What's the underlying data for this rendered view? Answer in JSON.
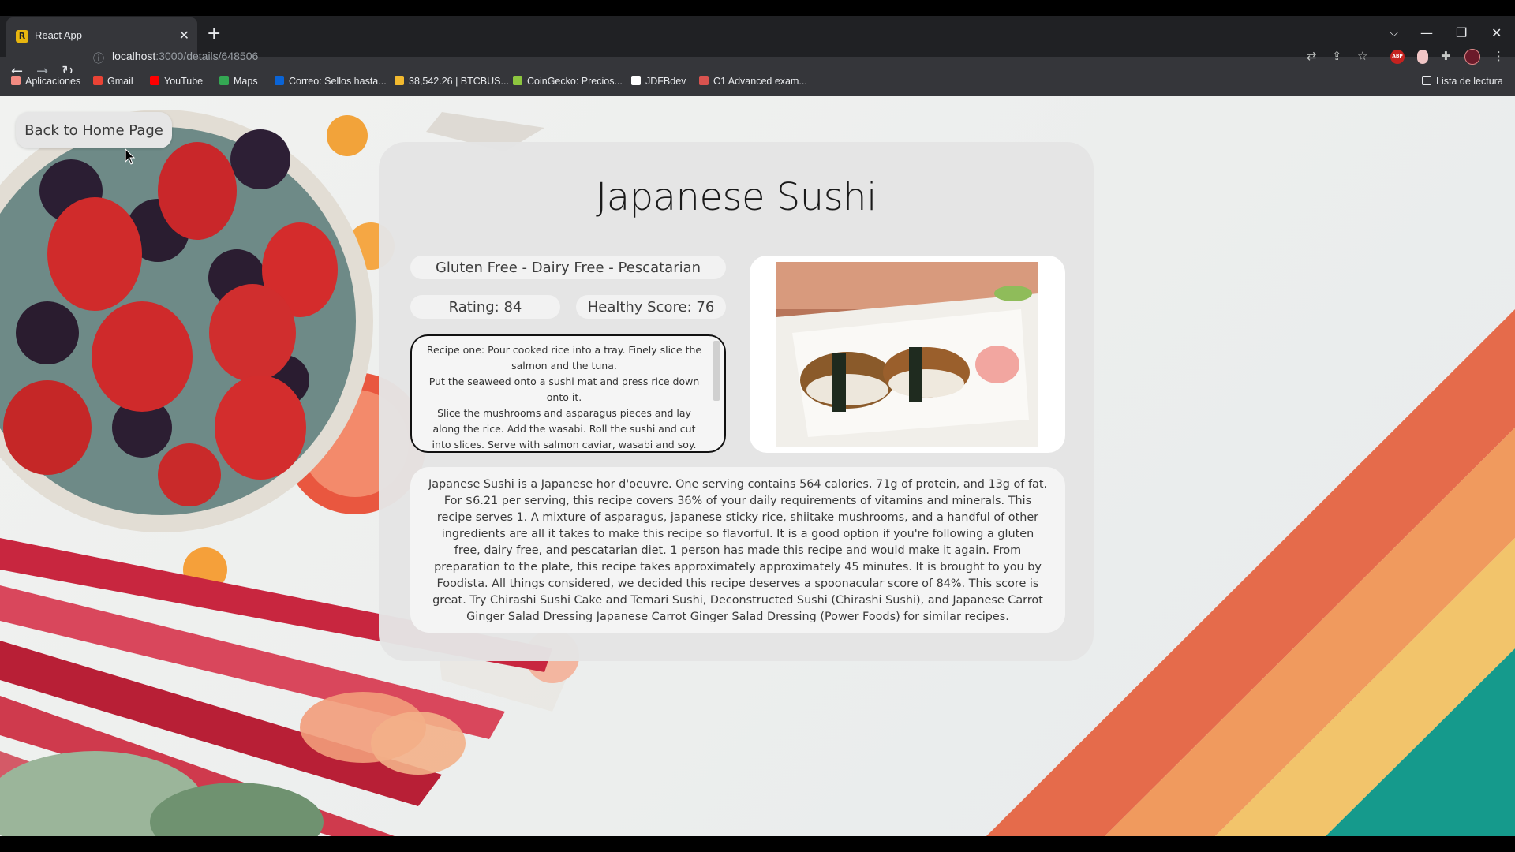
{
  "browser": {
    "tab_title": "React App",
    "url_host": "localhost",
    "url_path": ":3000/details/648506",
    "bookmarks": [
      {
        "label": "Aplicaciones",
        "icon": "apps-grid-icon",
        "color": "#f28b82"
      },
      {
        "label": "Gmail",
        "icon": "gmail-icon",
        "color": "#ea4335"
      },
      {
        "label": "YouTube",
        "icon": "youtube-icon",
        "color": "#ff0000"
      },
      {
        "label": "Maps",
        "icon": "maps-pin-icon",
        "color": "#34a853"
      },
      {
        "label": "Correo: Sellos hasta...",
        "icon": "outlook-icon",
        "color": "#0a64d6"
      },
      {
        "label": "38,542.26 | BTCBUS...",
        "icon": "binance-icon",
        "color": "#f3ba2f"
      },
      {
        "label": "CoinGecko: Precios...",
        "icon": "coingecko-icon",
        "color": "#8dc63f"
      },
      {
        "label": "JDFBdev",
        "icon": "github-icon",
        "color": "#ffffff"
      },
      {
        "label": "C1 Advanced exam...",
        "icon": "cambridge-icon",
        "color": "#d9534f"
      }
    ],
    "reading_list": "Lista de lectura"
  },
  "page": {
    "back_button": "Back to Home Page",
    "recipe": {
      "title": "Japanese Sushi",
      "diets": "Gluten Free - Dairy Free - Pescatarian",
      "rating": "Rating: 84",
      "health_score": "Healthy Score: 76",
      "instructions": [
        "Recipe one: Pour cooked rice into a tray. Finely slice the salmon and the tuna.",
        "Put the seaweed onto a sushi mat and press rice down onto it.",
        "Slice the mushrooms and asparagus pieces and lay along the rice. Add the wasabi. Roll the sushi and cut into slices. Serve with salmon caviar, wasabi and soy."
      ],
      "summary": "Japanese Sushi is a Japanese hor d'oeuvre. One serving contains 564 calories, 71g of protein, and 13g of fat. For $6.21 per serving, this recipe covers 36% of your daily requirements of vitamins and minerals. This recipe serves 1. A mixture of asparagus, japanese sticky rice, shiitake mushrooms, and a handful of other ingredients are all it takes to make this recipe so flavorful. It is a good option if you're following a gluten free, dairy free, and pescatarian diet. 1 person has made this recipe and would make it again. From preparation to the plate, this recipe takes approximately approximately 45 minutes. It is brought to you by Foodista. All things considered, we decided this recipe deserves a spoonacular score of 84%. This score is great. Try Chirashi Sushi Cake and Temari Sushi, Deconstructed Sushi (Chirashi Sushi), and Japanese Carrot Ginger Salad Dressing Japanese Carrot Ginger Salad Dressing (Power Foods) for similar recipes."
    }
  }
}
